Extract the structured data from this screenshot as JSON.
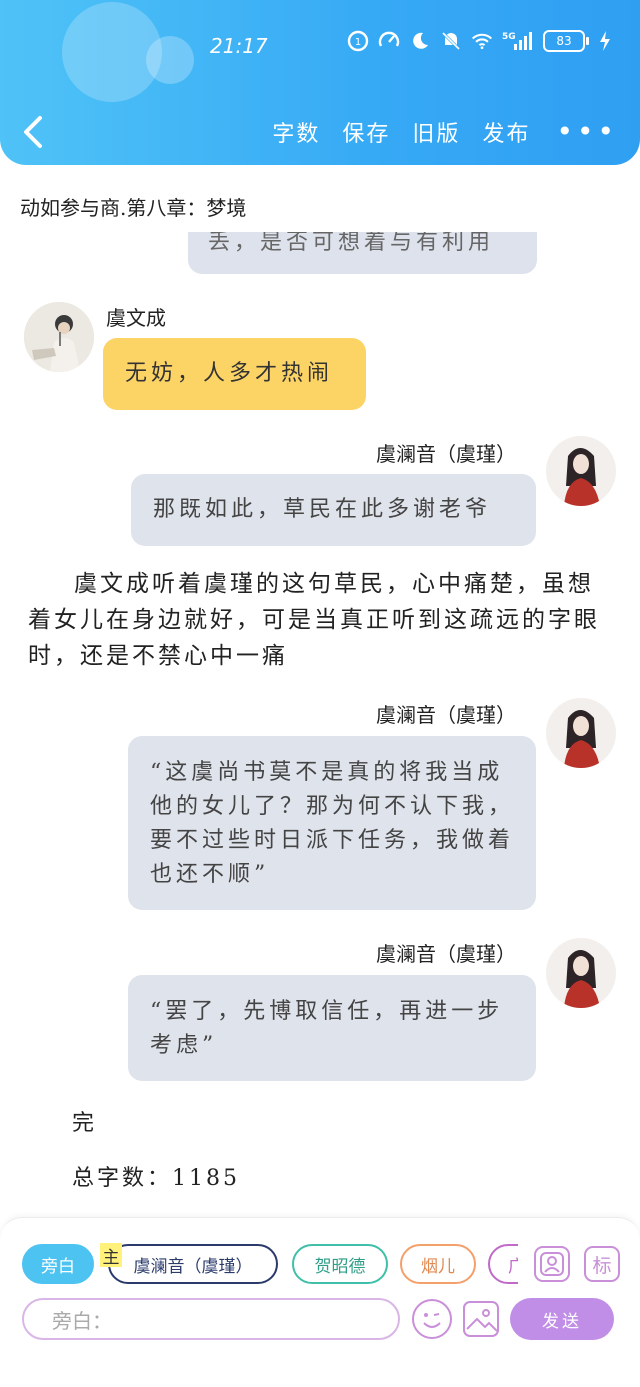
{
  "status_bar": {
    "time": "21:17",
    "battery": "83",
    "icons": [
      "data-saver-icon",
      "speed-icon",
      "moon-icon",
      "mute-bell-icon",
      "wifi-icon",
      "5g-signal-icon",
      "battery-icon",
      "charging-icon"
    ]
  },
  "header": {
    "back_icon": "chevron-left-icon",
    "actions": [
      "字数",
      "保存",
      "旧版",
      "发布"
    ],
    "more_icon": "more-dots-icon"
  },
  "chapter_title": "动如参与商.第八章：梦境",
  "previous_fragment": "丢，是否可想着与有利用",
  "messages": [
    {
      "speaker": "虞文成",
      "text": "无妨，人多才热闹",
      "side": "left"
    },
    {
      "speaker": "虞澜音（虞瑾）",
      "text": "那既如此，草民在此多谢老爷",
      "side": "right"
    }
  ],
  "narration": "虞文成听着虞瑾的这句草民，心中痛楚，虽想着女儿在身边就好，可是当真正听到这疏远的字眼时，还是不禁心中一痛",
  "messages2": [
    {
      "speaker": "虞澜音（虞瑾）",
      "text": "“这虞尚书莫不是真的将我当成他的女儿了？那为何不认下我，要不过些时日派下任务，我做着也还不顺”"
    },
    {
      "speaker": "虞澜音（虞瑾）",
      "text": "“罢了，先博取信任，再进一步考虑”"
    }
  ],
  "end_text": "完",
  "total_words": "总字数：1185",
  "toolbar": {
    "chips": [
      "旁白",
      "虞澜音（虞瑾）",
      "贺昭德",
      "烟儿",
      "广"
    ],
    "main_tag": "主",
    "input_placeholder": "旁白：",
    "send_label": "发送",
    "tool_icons": [
      "character-icon",
      "label-icon",
      "emoji-icon",
      "image-icon"
    ],
    "label_btn": "标"
  },
  "colors": {
    "header": "#36a9f5",
    "yellow_bubble": "#fcd466",
    "gray_bubble": "#dfe3ec",
    "send": "#c08ee6",
    "active_chip": "#4cc3f1"
  }
}
